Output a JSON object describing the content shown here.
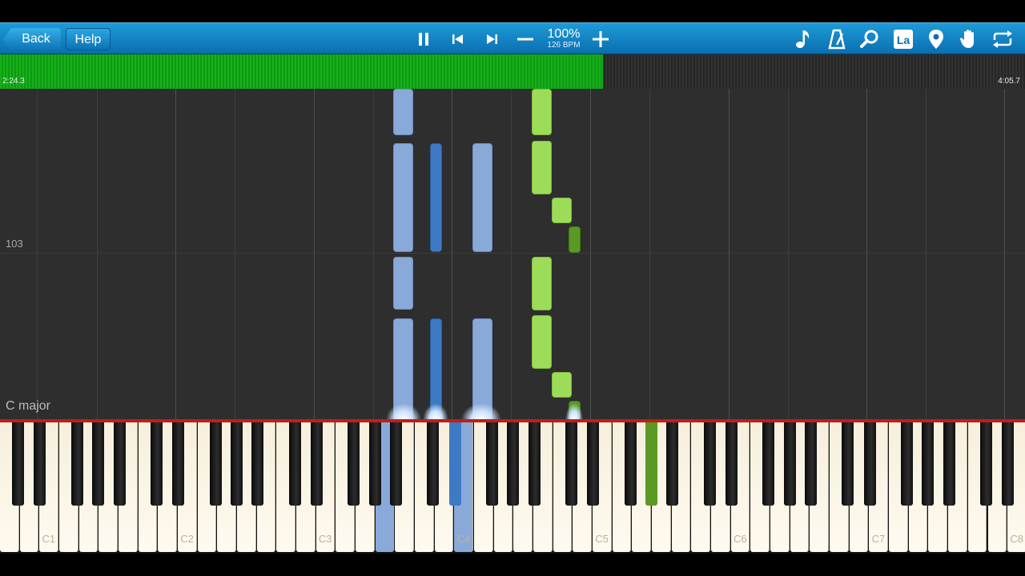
{
  "toolbar": {
    "back_label": "Back",
    "help_label": "Help",
    "speed_percent": "100%",
    "tempo": "126 BPM",
    "icons": [
      "pause-icon",
      "skip-back-icon",
      "skip-forward-icon",
      "minus-icon",
      "plus-icon",
      "music-note-icon",
      "metronome-icon",
      "magnifier-icon",
      "key-label-icon",
      "location-pin-icon",
      "hand-icon",
      "loop-icon"
    ]
  },
  "progress": {
    "elapsed": "2:24.3",
    "total": "4:05.7",
    "fraction": 0.588
  },
  "roll": {
    "measure_number": "103",
    "key_signature": "C major"
  },
  "keyboard": {
    "octave_labels": [
      "C1",
      "C2",
      "C3",
      "C4",
      "C5",
      "C6",
      "C7",
      "C8"
    ]
  },
  "colors": {
    "toolbar_blue": "#0a6fb0",
    "progress_green": "#17b11a",
    "right_hand_light": "#9ddc58",
    "right_hand_dark": "#5a9a24",
    "left_hand_light": "#89a9d9",
    "left_hand_dark": "#3e79c4",
    "keyboard_line": "#c21c1c"
  }
}
